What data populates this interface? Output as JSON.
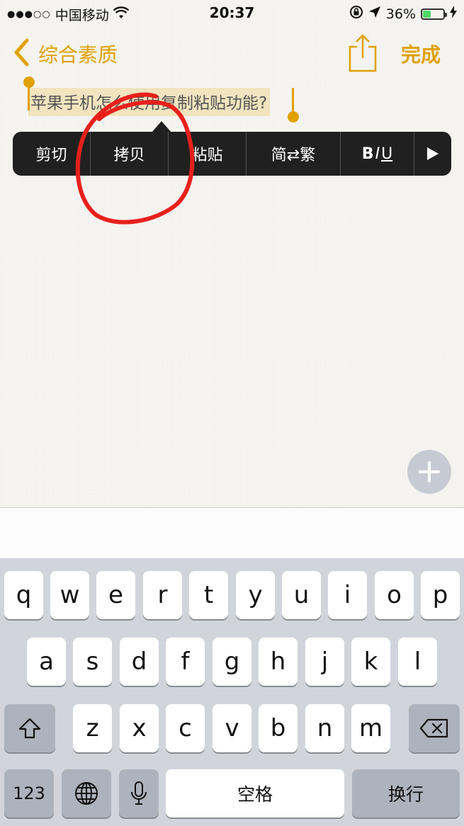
{
  "status_bar": {
    "signal": "●●●○○",
    "carrier": "中国移动",
    "time": "20:37",
    "battery_percent": "36%",
    "battery_level": 0.36,
    "icons": [
      "wifi-icon",
      "lock-rotation-icon",
      "location-icon",
      "battery-icon",
      "charging-icon"
    ]
  },
  "nav": {
    "back_label": "综合素质",
    "done_label": "完成",
    "accent_color": "#e0a100"
  },
  "note": {
    "text": "苹果手机怎么使用复制粘贴功能?",
    "selection_color": "#f1e4bf"
  },
  "context_menu": {
    "items": [
      "剪切",
      "拷贝",
      "粘贴",
      "简⇄繁"
    ],
    "format": {
      "bold": "B",
      "italic": "I",
      "underline": "U"
    },
    "more_icon": "play-triangle-icon"
  },
  "annotation_color": "#e8201c",
  "keyboard": {
    "row1": [
      "q",
      "w",
      "e",
      "r",
      "t",
      "y",
      "u",
      "i",
      "o",
      "p"
    ],
    "row2": [
      "a",
      "s",
      "d",
      "f",
      "g",
      "h",
      "j",
      "k",
      "l"
    ],
    "row3": [
      "z",
      "x",
      "c",
      "v",
      "b",
      "n",
      "m"
    ],
    "numbers_label": "123",
    "space_label": "空格",
    "return_label": "换行"
  }
}
